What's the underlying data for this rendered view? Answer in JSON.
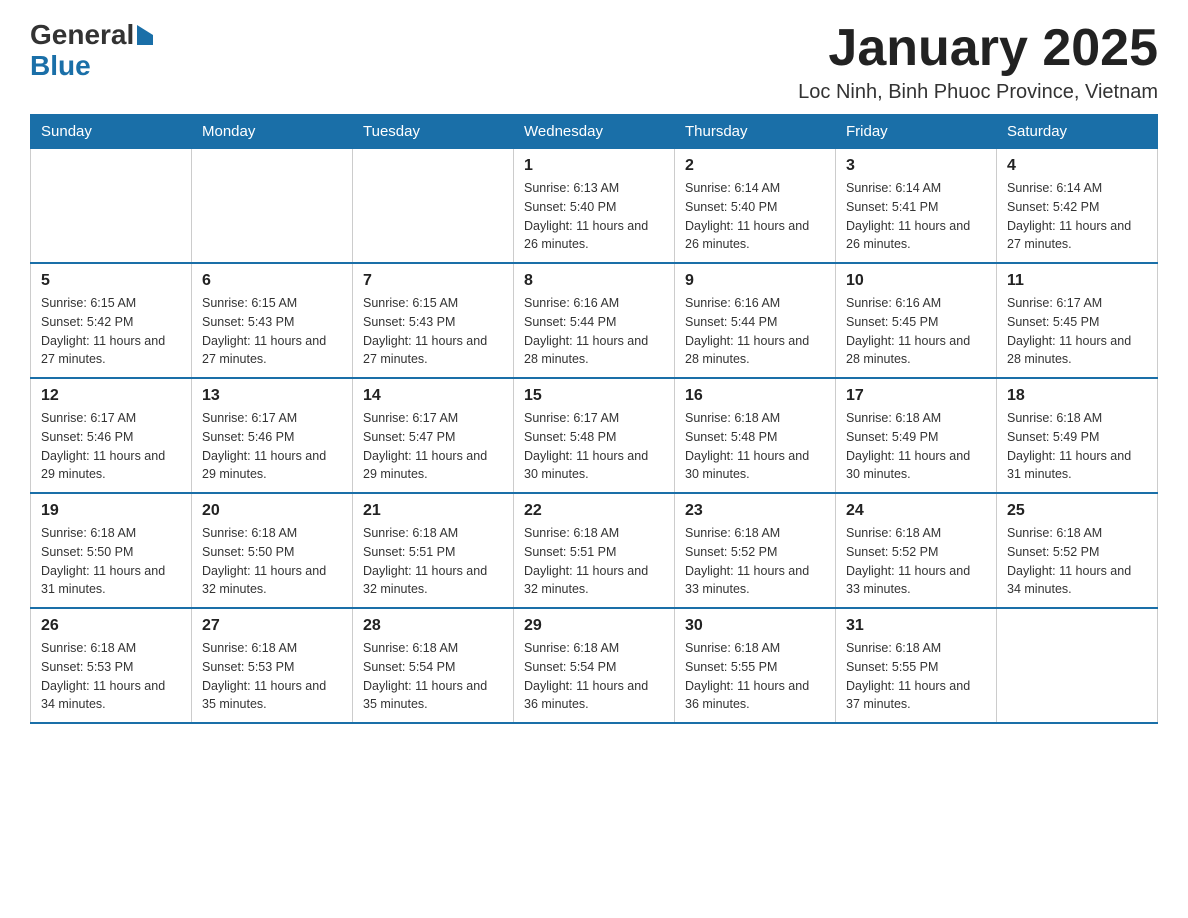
{
  "logo": {
    "line1": "General",
    "line2": "Blue"
  },
  "title": {
    "month_year": "January 2025",
    "location": "Loc Ninh, Binh Phuoc Province, Vietnam"
  },
  "calendar": {
    "headers": [
      "Sunday",
      "Monday",
      "Tuesday",
      "Wednesday",
      "Thursday",
      "Friday",
      "Saturday"
    ],
    "weeks": [
      [
        {
          "day": "",
          "info": ""
        },
        {
          "day": "",
          "info": ""
        },
        {
          "day": "",
          "info": ""
        },
        {
          "day": "1",
          "info": "Sunrise: 6:13 AM\nSunset: 5:40 PM\nDaylight: 11 hours and 26 minutes."
        },
        {
          "day": "2",
          "info": "Sunrise: 6:14 AM\nSunset: 5:40 PM\nDaylight: 11 hours and 26 minutes."
        },
        {
          "day": "3",
          "info": "Sunrise: 6:14 AM\nSunset: 5:41 PM\nDaylight: 11 hours and 26 minutes."
        },
        {
          "day": "4",
          "info": "Sunrise: 6:14 AM\nSunset: 5:42 PM\nDaylight: 11 hours and 27 minutes."
        }
      ],
      [
        {
          "day": "5",
          "info": "Sunrise: 6:15 AM\nSunset: 5:42 PM\nDaylight: 11 hours and 27 minutes."
        },
        {
          "day": "6",
          "info": "Sunrise: 6:15 AM\nSunset: 5:43 PM\nDaylight: 11 hours and 27 minutes."
        },
        {
          "day": "7",
          "info": "Sunrise: 6:15 AM\nSunset: 5:43 PM\nDaylight: 11 hours and 27 minutes."
        },
        {
          "day": "8",
          "info": "Sunrise: 6:16 AM\nSunset: 5:44 PM\nDaylight: 11 hours and 28 minutes."
        },
        {
          "day": "9",
          "info": "Sunrise: 6:16 AM\nSunset: 5:44 PM\nDaylight: 11 hours and 28 minutes."
        },
        {
          "day": "10",
          "info": "Sunrise: 6:16 AM\nSunset: 5:45 PM\nDaylight: 11 hours and 28 minutes."
        },
        {
          "day": "11",
          "info": "Sunrise: 6:17 AM\nSunset: 5:45 PM\nDaylight: 11 hours and 28 minutes."
        }
      ],
      [
        {
          "day": "12",
          "info": "Sunrise: 6:17 AM\nSunset: 5:46 PM\nDaylight: 11 hours and 29 minutes."
        },
        {
          "day": "13",
          "info": "Sunrise: 6:17 AM\nSunset: 5:46 PM\nDaylight: 11 hours and 29 minutes."
        },
        {
          "day": "14",
          "info": "Sunrise: 6:17 AM\nSunset: 5:47 PM\nDaylight: 11 hours and 29 minutes."
        },
        {
          "day": "15",
          "info": "Sunrise: 6:17 AM\nSunset: 5:48 PM\nDaylight: 11 hours and 30 minutes."
        },
        {
          "day": "16",
          "info": "Sunrise: 6:18 AM\nSunset: 5:48 PM\nDaylight: 11 hours and 30 minutes."
        },
        {
          "day": "17",
          "info": "Sunrise: 6:18 AM\nSunset: 5:49 PM\nDaylight: 11 hours and 30 minutes."
        },
        {
          "day": "18",
          "info": "Sunrise: 6:18 AM\nSunset: 5:49 PM\nDaylight: 11 hours and 31 minutes."
        }
      ],
      [
        {
          "day": "19",
          "info": "Sunrise: 6:18 AM\nSunset: 5:50 PM\nDaylight: 11 hours and 31 minutes."
        },
        {
          "day": "20",
          "info": "Sunrise: 6:18 AM\nSunset: 5:50 PM\nDaylight: 11 hours and 32 minutes."
        },
        {
          "day": "21",
          "info": "Sunrise: 6:18 AM\nSunset: 5:51 PM\nDaylight: 11 hours and 32 minutes."
        },
        {
          "day": "22",
          "info": "Sunrise: 6:18 AM\nSunset: 5:51 PM\nDaylight: 11 hours and 32 minutes."
        },
        {
          "day": "23",
          "info": "Sunrise: 6:18 AM\nSunset: 5:52 PM\nDaylight: 11 hours and 33 minutes."
        },
        {
          "day": "24",
          "info": "Sunrise: 6:18 AM\nSunset: 5:52 PM\nDaylight: 11 hours and 33 minutes."
        },
        {
          "day": "25",
          "info": "Sunrise: 6:18 AM\nSunset: 5:52 PM\nDaylight: 11 hours and 34 minutes."
        }
      ],
      [
        {
          "day": "26",
          "info": "Sunrise: 6:18 AM\nSunset: 5:53 PM\nDaylight: 11 hours and 34 minutes."
        },
        {
          "day": "27",
          "info": "Sunrise: 6:18 AM\nSunset: 5:53 PM\nDaylight: 11 hours and 35 minutes."
        },
        {
          "day": "28",
          "info": "Sunrise: 6:18 AM\nSunset: 5:54 PM\nDaylight: 11 hours and 35 minutes."
        },
        {
          "day": "29",
          "info": "Sunrise: 6:18 AM\nSunset: 5:54 PM\nDaylight: 11 hours and 36 minutes."
        },
        {
          "day": "30",
          "info": "Sunrise: 6:18 AM\nSunset: 5:55 PM\nDaylight: 11 hours and 36 minutes."
        },
        {
          "day": "31",
          "info": "Sunrise: 6:18 AM\nSunset: 5:55 PM\nDaylight: 11 hours and 37 minutes."
        },
        {
          "day": "",
          "info": ""
        }
      ]
    ]
  }
}
